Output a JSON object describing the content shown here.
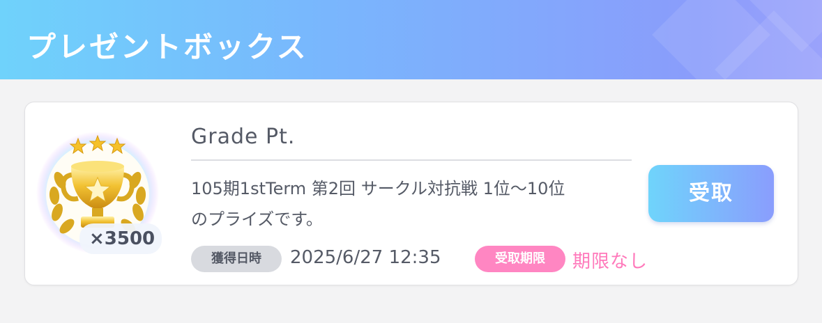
{
  "header": {
    "title": "プレゼントボックス"
  },
  "present": {
    "item_name": "Grade Pt.",
    "quantity": "×3500",
    "description_lines": [
      "105期1stTerm 第2回 サークル対抗戦 1位～10位",
      "のプライズです。"
    ],
    "acquired_label": "獲得日時",
    "acquired_datetime": "2025/6/27 12:35",
    "deadline_label": "受取期限",
    "deadline_value": "期限なし",
    "receive_button_label": "受取",
    "icon": "trophy-icon",
    "stars": 3
  },
  "colors": {
    "header_gradient_start": "#6fd2fb",
    "header_gradient_end": "#9aa2fb",
    "deadline_pink": "#ff79bb",
    "button_gradient_start": "#6fd4fb",
    "button_gradient_end": "#8a9dfd"
  }
}
